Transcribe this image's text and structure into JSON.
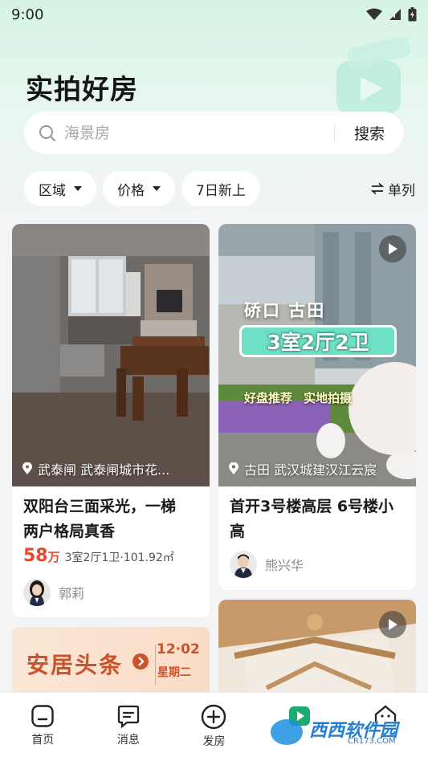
{
  "status": {
    "time": "9:00"
  },
  "header": {
    "title": "实拍好房"
  },
  "search": {
    "placeholder": "海景房",
    "button_label": "搜索"
  },
  "filters": {
    "chips": [
      {
        "label": "区域",
        "dropdown": true
      },
      {
        "label": "价格",
        "dropdown": true
      },
      {
        "label": "7日新上",
        "dropdown": false
      }
    ],
    "layout_toggle_label": "单列"
  },
  "listings": [
    {
      "location": "武泰闸 武泰闸城市花...",
      "title_line1": "双阳台三面采光，一梯",
      "title_line2": "两户格局真香",
      "price": "58",
      "price_unit": "万",
      "spec": "3室2厅1卫·101.92㎡",
      "agent": "郭莉",
      "has_video": false
    },
    {
      "location": "古田 武汉城建汉江云宸",
      "overlay_area": "硚口 古田",
      "overlay_layout": "3室2厅2卫",
      "overlay_tag1": "好盘推荐",
      "overlay_tag2": "实地拍摄",
      "title_line1": "首开3号楼高层 6号楼小",
      "title_line2": "高",
      "agent": "熊兴华",
      "has_video": true
    }
  ],
  "banner": {
    "text": "安居头条",
    "date": "12·02",
    "weekday": "星期二"
  },
  "bottom_nav": {
    "items": [
      {
        "label": "首页",
        "icon": "home-icon"
      },
      {
        "label": "消息",
        "icon": "message-icon"
      },
      {
        "label": "发房",
        "icon": "plus-circle-icon"
      },
      {
        "label": "",
        "icon": "video-icon"
      },
      {
        "label": "",
        "icon": "profile-icon"
      }
    ]
  },
  "watermark": {
    "text": "西西软件园",
    "url_text": "CR173.COM"
  },
  "colors": {
    "accent": "#1aad6f",
    "price": "#e8492e",
    "header_bg": "#d6f3e6"
  }
}
